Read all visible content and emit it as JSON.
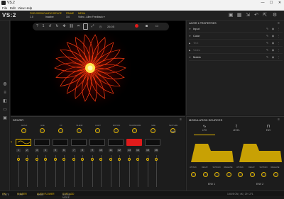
{
  "window": {
    "title": "VS.2",
    "min": "—",
    "max": "☐",
    "close": "✕"
  },
  "menu": [
    "File",
    "Edit",
    "View",
    "Help"
  ],
  "logo": "VS:2",
  "header": {
    "cols": [
      {
        "k": "PIXELS/DEMO",
        "v": "1.0"
      },
      {
        "k": "AUDIO DEVICE",
        "v": "Inactive"
      },
      {
        "k": "FRAME",
        "v": "1/4"
      },
      {
        "k": "MEDIA",
        "v": "Video - Alien Feedback ▾"
      }
    ]
  },
  "viewport_toolbar": {
    "value": "1",
    "time": "26:05"
  },
  "right_panel": {
    "title": "LAYER 1 PROPERTIES",
    "rows": [
      {
        "label": "Input",
        "expanded": true,
        "dim": false
      },
      {
        "label": "Color",
        "expanded": true,
        "dim": false
      },
      {
        "label": "Text",
        "expanded": false,
        "dim": true
      },
      {
        "label": "Video",
        "expanded": false,
        "dim": true
      },
      {
        "label": "Matrix",
        "expanded": true,
        "dim": false
      }
    ]
  },
  "driver": {
    "title": "DRIVER",
    "knob_labels": [
      "ALPHA",
      "HUE",
      "FX",
      "BLEND",
      "LIGHT",
      "MOTION",
      "TRANSFORM",
      "SIZE",
      "TEXTURE"
    ],
    "home_label": "HOME",
    "slot_numbers": [
      [
        "1",
        "2"
      ],
      [
        "3",
        "4"
      ],
      [
        "5",
        "6"
      ],
      [
        "7",
        "8"
      ],
      [
        "9",
        "10"
      ],
      [
        "11",
        "12"
      ],
      [
        "13",
        "14"
      ],
      [
        "15",
        "16"
      ]
    ]
  },
  "modulation": {
    "title": "MODULATION SOURCES",
    "tabs": [
      "LFO",
      "LEVEL",
      "ENV"
    ],
    "env_labels": [
      "ATTACK",
      "DECAY",
      "SUSTAIN",
      "RELEASE",
      "ATTACK",
      "DECAY",
      "SUSTAIN",
      "RELEASE"
    ],
    "env_names": [
      "ENV 1",
      "ENV 2"
    ]
  },
  "status": {
    "state_k": "STATE",
    "state_v": "ON",
    "type_k": "TYPE",
    "type_v": "SHADER",
    "name_k": "NAME",
    "name_v": "ALIEN FLOWER",
    "blend_k": "BLEND MODE",
    "blend_v": "SOFT ADD",
    "right": "1/4K/8  ON  |  4K  |  29 / 271"
  },
  "colors": {
    "accent": "#e6b800",
    "red": "#e01b1b"
  }
}
